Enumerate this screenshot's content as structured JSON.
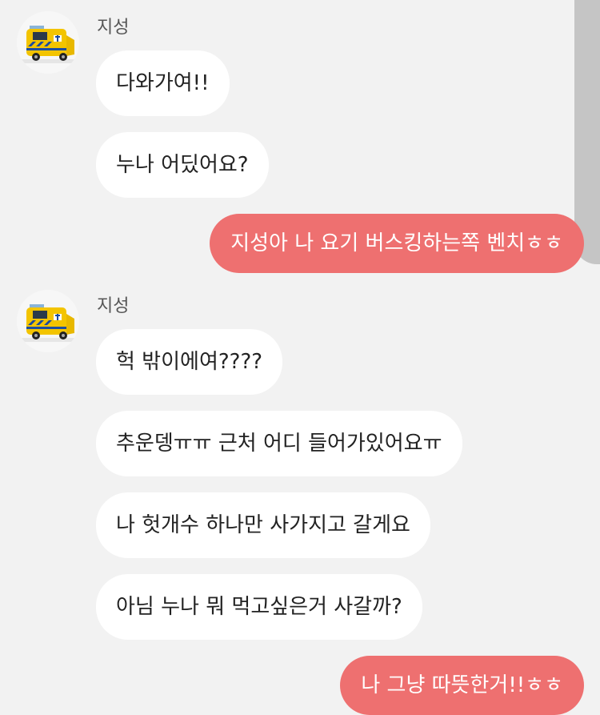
{
  "chat": {
    "groups": [
      {
        "sender": "지성",
        "messages": [
          "다와가여!!",
          "누나 어딨어요?"
        ]
      },
      {
        "sender": "지성",
        "messages": [
          "헉 밖이에여????",
          "추운뎅ㅠㅠ 근처 어디 들어가있어요ㅠ",
          "나 헛개수 하나만 사가지고 갈게요",
          "아님 누나 뭐 먹고싶은거 사갈까?"
        ]
      }
    ],
    "outgoing": [
      "지성아 나 요기 버스킹하는쪽 벤치ㅎㅎ",
      "나 그냥 따뜻한거!!ㅎㅎ"
    ]
  },
  "colors": {
    "background": "#f2f2f2",
    "incoming_bubble": "#ffffff",
    "outgoing_bubble": "#ee7070"
  },
  "icons": {
    "avatar": "yellow-ambulance-avatar-icon"
  }
}
